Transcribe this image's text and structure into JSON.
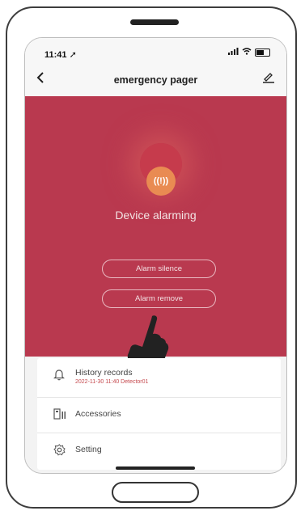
{
  "status_bar": {
    "time": "11:41",
    "time_icon": "location-arrow-icon",
    "signal": "signal-icon",
    "wifi": "wifi-icon",
    "battery": "battery-icon"
  },
  "nav": {
    "title": "emergency pager",
    "back_icon": "chevron-left-icon",
    "edit_icon": "edit-pencil-icon"
  },
  "alarm": {
    "status_text": "Device alarming",
    "icon": "alarm-sound-icon",
    "icon_glyph": "((!))",
    "silence_label": "Alarm silence",
    "remove_label": "Alarm remove",
    "overlay_color": "#b9394f",
    "icon_color": "#e98b52"
  },
  "menu": {
    "items": [
      {
        "label": "History records",
        "subtitle": "2022-11-30 11:40 Detector01",
        "icon": "bell-icon"
      },
      {
        "label": "Accessories",
        "icon": "devices-icon"
      },
      {
        "label": "Setting",
        "icon": "gear-icon"
      }
    ],
    "subtitle_color": "#c5494e"
  }
}
